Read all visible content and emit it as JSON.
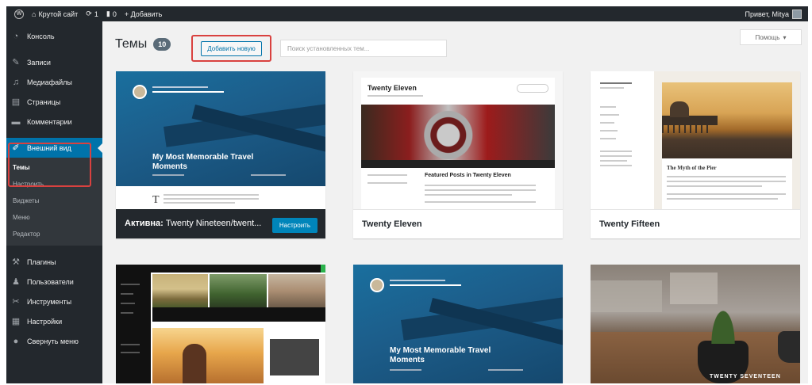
{
  "adminbar": {
    "site_name": "Крутой сайт",
    "updates_count": "1",
    "comments_count": "0",
    "add_new": "+ Добавить",
    "greeting": "Привет, Mitya"
  },
  "sidebar": {
    "items": [
      {
        "label": "Консоль",
        "icon": "dashboard-icon"
      },
      {
        "label": "Записи",
        "icon": "pin-icon"
      },
      {
        "label": "Медиафайлы",
        "icon": "media-icon"
      },
      {
        "label": "Страницы",
        "icon": "pages-icon"
      },
      {
        "label": "Комментарии",
        "icon": "comments-icon"
      },
      {
        "label": "Внешний вид",
        "icon": "brush-icon"
      }
    ],
    "submenu": [
      "Темы",
      "Настроить",
      "Виджеты",
      "Меню",
      "Редактор"
    ],
    "items_after": [
      {
        "label": "Плагины",
        "icon": "plugins-icon"
      },
      {
        "label": "Пользователи",
        "icon": "users-icon"
      },
      {
        "label": "Инструменты",
        "icon": "tools-icon"
      },
      {
        "label": "Настройки",
        "icon": "settings-icon"
      },
      {
        "label": "Свернуть меню",
        "icon": "collapse-icon"
      }
    ]
  },
  "header": {
    "title": "Темы",
    "count": "10",
    "add_new_label": "Добавить новую",
    "search_placeholder": "Поиск установленных тем...",
    "help_label": "Помощь"
  },
  "themes": [
    {
      "name": "Twenty Nineteen/twent...",
      "active": true,
      "active_prefix": "Активна:",
      "customize_label": "Настроить",
      "preview_title": "My Most Memorable Travel Moments"
    },
    {
      "name": "Twenty Eleven",
      "preview_title": "Twenty Eleven",
      "preview_heading": "Featured Posts in Twenty Eleven"
    },
    {
      "name": "Twenty Fifteen",
      "preview_heading": "The Myth of the Pier"
    },
    {
      "name": "",
      "preview_title": ""
    },
    {
      "name": "",
      "preview_title": "My Most Memorable Travel Moments"
    },
    {
      "name": "",
      "preview_title": "TWENTY SEVENTEEN"
    }
  ],
  "colors": {
    "adminbar": "#23282d",
    "accent": "#0073aa",
    "highlight": "#d9413f"
  }
}
